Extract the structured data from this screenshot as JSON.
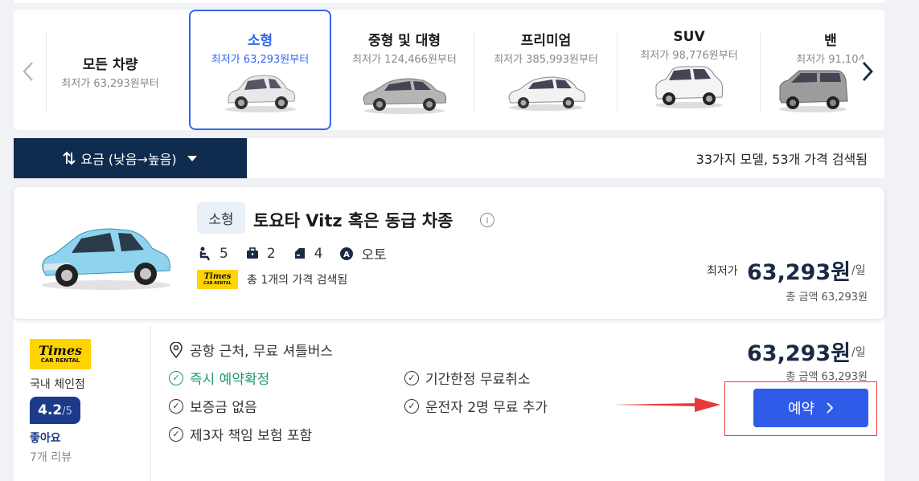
{
  "categories": [
    {
      "name": "모든 차량",
      "price": "최저가 63,293원부터",
      "selected": false
    },
    {
      "name": "소형",
      "price": "최저가 63,293원부터",
      "selected": true
    },
    {
      "name": "중형 및 대형",
      "price": "최저가 124,466원부터",
      "selected": false
    },
    {
      "name": "프리미엄",
      "price": "최저가 385,993원부터",
      "selected": false
    },
    {
      "name": "SUV",
      "price": "최저가 98,776원부터",
      "selected": false
    },
    {
      "name": "밴",
      "price": "최저가 91,104",
      "selected": false
    }
  ],
  "sort": {
    "label": "요금 (낮음→높음)"
  },
  "results_summary": "33가지 모델, 53개 가격 검색됨",
  "car": {
    "type_chip": "소형",
    "title": "토요타 Vitz 혹은 동급 차종",
    "info_icon_glyph": "i",
    "specs": {
      "seats": "5",
      "bags": "2",
      "doors": "4",
      "transmission": "오토"
    },
    "supplier_logo": {
      "line1": "Times",
      "line2": "CAR RENTAL"
    },
    "found_count": "총 1개의 가격 검색됨",
    "from_label": "최저가",
    "price": "63,293원",
    "per_day": "/일",
    "total": "총 금액 63,293원"
  },
  "supplier": {
    "logo": {
      "line1": "Times",
      "line2": "CAR RENTAL"
    },
    "type": "국내 체인점",
    "rating_score": "4.2",
    "rating_out": "/5",
    "rating_word": "좋아요",
    "reviews": "7개 리뷰",
    "features": {
      "location": "공항 근처, 무료 셔틀버스",
      "instant": "즉시 예약확정",
      "cancel": "기간한정 무료취소",
      "deposit": "보증금 없음",
      "drivers": "운전자 2명 무료 추가",
      "insurance": "제3자 책임 보험 포함"
    },
    "price": "63,293원",
    "per_day": "/일",
    "total": "총 금액 63,293원",
    "book_label": "예약"
  },
  "colors": {
    "navy": "#0f2b4d",
    "accent_blue": "#3366ee",
    "book_blue": "#2f5be8",
    "green": "#1a9a6a",
    "highlight_red": "#e83a3a",
    "times_yellow": "#ffd400"
  }
}
